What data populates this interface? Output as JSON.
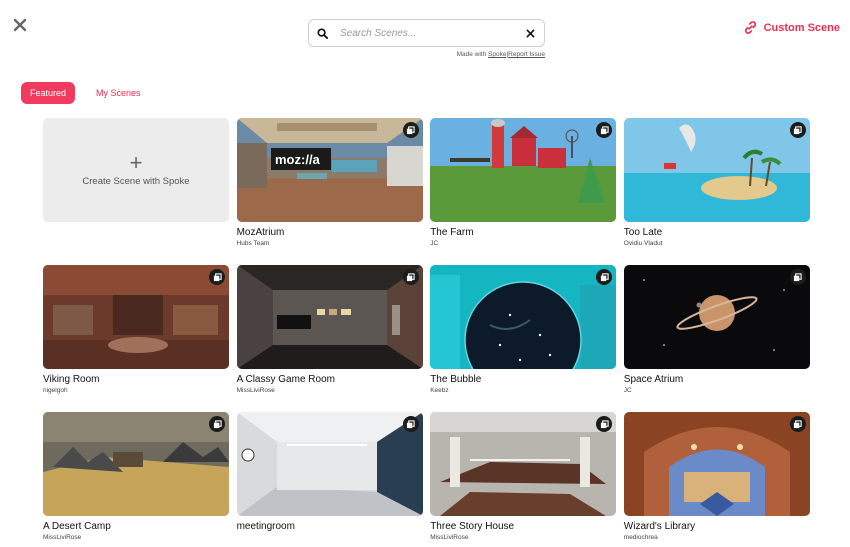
{
  "header": {
    "close_icon": "close-icon",
    "search": {
      "placeholder": "Search Scenes...",
      "value": ""
    },
    "made_with_prefix": "Made with ",
    "spoke_link": "Spoke",
    "separator": "|",
    "report_link": "Report Issue",
    "custom_scene_label": "Custom Scene"
  },
  "tabs": [
    {
      "label": "Featured",
      "active": true
    },
    {
      "label": "My Scenes",
      "active": false
    }
  ],
  "create_card": {
    "label": "Create Scene with Spoke",
    "plus": "+"
  },
  "scenes": [
    {
      "title": "MozAtrium",
      "author": "Hubs Team"
    },
    {
      "title": "The Farm",
      "author": "JC"
    },
    {
      "title": "Too Late",
      "author": "Ovidiu Vladut"
    },
    {
      "title": "Viking Room",
      "author": "nigelgoh"
    },
    {
      "title": "A Classy Game Room",
      "author": "MissLiviRose"
    },
    {
      "title": "The Bubble",
      "author": "Keebz"
    },
    {
      "title": "Space Atrium",
      "author": "JC"
    },
    {
      "title": "A Desert Camp",
      "author": "MissLiviRose"
    },
    {
      "title": "meetingroom",
      "author": ""
    },
    {
      "title": "Three Story House",
      "author": "MissLiviRose"
    },
    {
      "title": "Wizard's Library",
      "author": "mediochrea"
    }
  ],
  "moz_sign": "moz://a",
  "colors": {
    "accent": "#ee2d52",
    "tab_active": "#f23a5e"
  }
}
